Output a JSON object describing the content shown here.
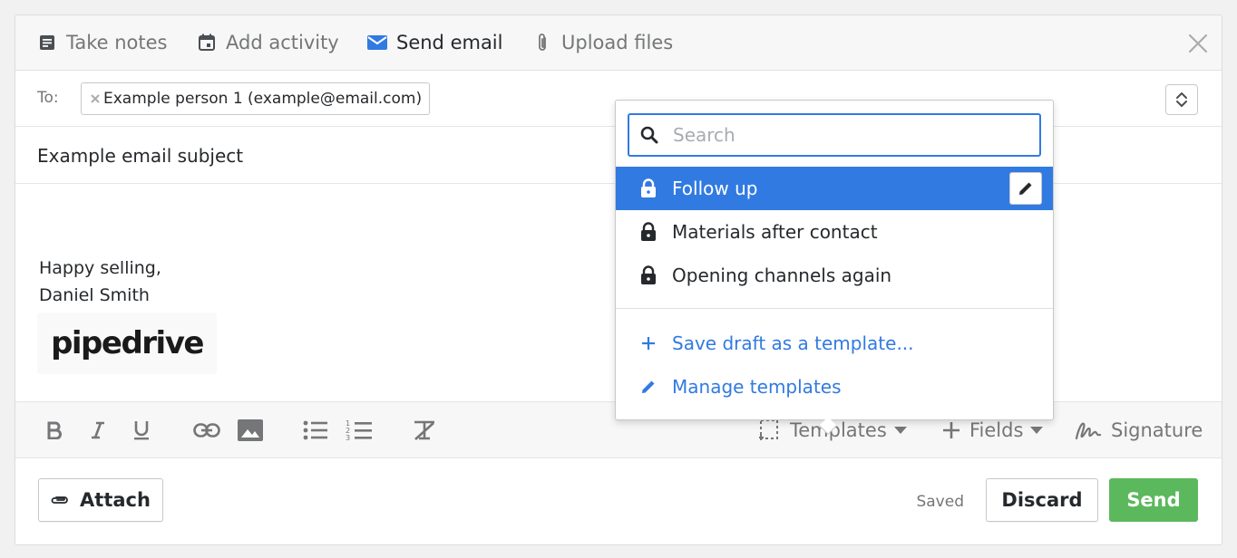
{
  "tabs": [
    {
      "label": "Take notes",
      "icon": "notes-icon"
    },
    {
      "label": "Add activity",
      "icon": "calendar-icon"
    },
    {
      "label": "Send email",
      "icon": "envelope-icon"
    },
    {
      "label": "Upload files",
      "icon": "paperclip-icon"
    }
  ],
  "active_tab": "Send email",
  "email": {
    "to_label": "To:",
    "recipient": "Example person 1 (example@email.com)",
    "subject": "Example email subject",
    "signature_line1": "Happy selling,",
    "signature_line2": "Daniel Smith",
    "logo_text": "pipedrive"
  },
  "toolbar": {
    "format_icons": [
      "bold-icon",
      "italic-icon",
      "underline-icon",
      "link-icon",
      "image-icon",
      "bullet-list-icon",
      "numbered-list-icon",
      "clear-format-icon"
    ],
    "templates_label": "Templates",
    "fields_label": "Fields",
    "signature_label": "Signature"
  },
  "footer": {
    "attach_label": "Attach",
    "saved_label": "Saved",
    "discard_label": "Discard",
    "send_label": "Send"
  },
  "templates_dropdown": {
    "search_placeholder": "Search",
    "items": [
      {
        "label": "Follow up",
        "selected": true
      },
      {
        "label": "Materials after contact",
        "selected": false
      },
      {
        "label": "Opening channels again",
        "selected": false
      }
    ],
    "save_draft_label": "Save draft as a template...",
    "manage_label": "Manage templates"
  },
  "colors": {
    "accent_blue": "#317ae2",
    "send_green": "#5cb85c",
    "text_dark": "#26292c",
    "text_muted": "#747678"
  }
}
